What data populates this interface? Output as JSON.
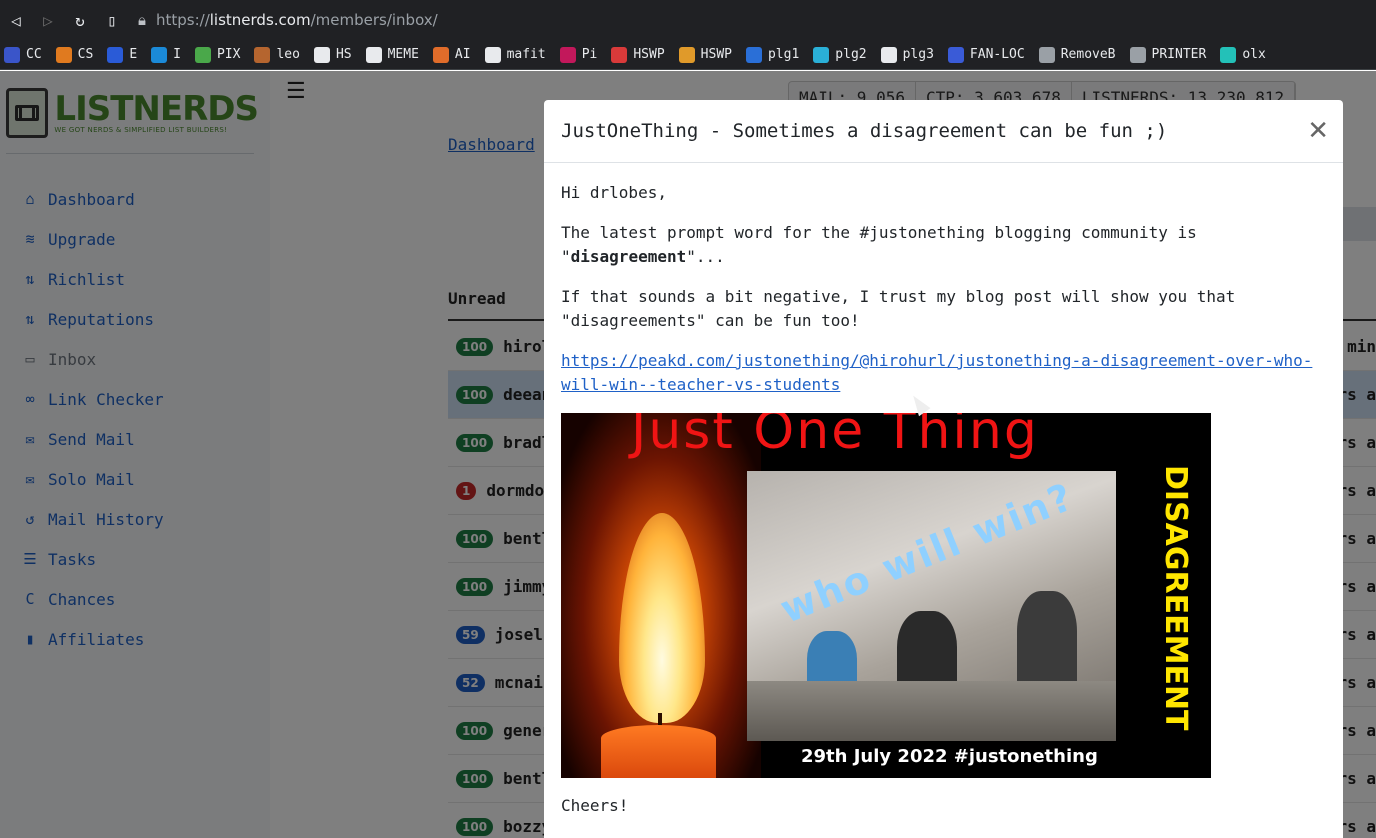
{
  "browser": {
    "url_scheme": "https://",
    "url_host": "listnerds.com",
    "url_path": "/members/inbox/",
    "bookmarks": [
      {
        "label": "CC",
        "color": "#3a55c9"
      },
      {
        "label": "CS",
        "color": "#e07a1f"
      },
      {
        "label": "E",
        "color": "#2a5bd7"
      },
      {
        "label": "I",
        "color": "#1b8ad8"
      },
      {
        "label": "PIX",
        "color": "#4aa84a"
      },
      {
        "label": "leo",
        "color": "#b5652f"
      },
      {
        "label": "HS",
        "color": "#e8eaed"
      },
      {
        "label": "MEME",
        "color": "#e8eaed"
      },
      {
        "label": "AI",
        "color": "#e06c2a"
      },
      {
        "label": "mafit",
        "color": "#e8eaed"
      },
      {
        "label": "Pi",
        "color": "#c2185b"
      },
      {
        "label": "HSWP",
        "color": "#d93a3a"
      },
      {
        "label": "HSWP",
        "color": "#e09a2a"
      },
      {
        "label": "plg1",
        "color": "#2a6fd7"
      },
      {
        "label": "plg2",
        "color": "#2ab0d7"
      },
      {
        "label": "plg3",
        "color": "#e8eaed"
      },
      {
        "label": "FAN-LOC",
        "color": "#3a5bd7"
      },
      {
        "label": "RemoveB",
        "color": "#9aa0a6"
      },
      {
        "label": "PRINTER",
        "color": "#9aa0a6"
      },
      {
        "label": "olx",
        "color": "#23c1b8"
      }
    ]
  },
  "logo": {
    "name": "LISTNERDS",
    "tagline": "WE GOT NERDS & SIMPLIFIED LIST BUILDERS!"
  },
  "sidebar": {
    "items": [
      {
        "label": "Dashboard",
        "icon": "home-icon",
        "glyph": "⌂"
      },
      {
        "label": "Upgrade",
        "icon": "layers-icon",
        "glyph": "≋"
      },
      {
        "label": "Richlist",
        "icon": "sort-icon",
        "glyph": "⇅"
      },
      {
        "label": "Reputations",
        "icon": "sort-icon",
        "glyph": "⇅"
      },
      {
        "label": "Inbox",
        "icon": "inbox-icon",
        "glyph": "▭"
      },
      {
        "label": "Link Checker",
        "icon": "link-icon",
        "glyph": "∞"
      },
      {
        "label": "Send Mail",
        "icon": "envelope-icon",
        "glyph": "✉"
      },
      {
        "label": "Solo Mail",
        "icon": "envelope-open-icon",
        "glyph": "✉"
      },
      {
        "label": "Mail History",
        "icon": "history-icon",
        "glyph": "↺"
      },
      {
        "label": "Tasks",
        "icon": "tasks-icon",
        "glyph": "☰"
      },
      {
        "label": "Chances",
        "icon": "chances-icon",
        "glyph": "C"
      },
      {
        "label": "Affiliates",
        "icon": "signal-icon",
        "glyph": "▮"
      }
    ]
  },
  "stats": {
    "mail": "MAIL: 9,056",
    "ctp": "CTP: 3,603,678",
    "listnerds": "LISTNERDS: 13,230,812"
  },
  "breadcrumb": "Dashboard",
  "table": {
    "header": "Unread",
    "rows": [
      {
        "badge": "100",
        "color": "green",
        "name": "hirol",
        "right": "min"
      },
      {
        "badge": "100",
        "color": "green",
        "name": "deean",
        "right": "rs a"
      },
      {
        "badge": "100",
        "color": "green",
        "name": "bradl",
        "right": "rs a"
      },
      {
        "badge": "1",
        "color": "red",
        "name": "dormdo",
        "right": "rs a"
      },
      {
        "badge": "100",
        "color": "green",
        "name": "bentl",
        "right": "rs a"
      },
      {
        "badge": "100",
        "color": "green",
        "name": "jimmy",
        "right": "rs a"
      },
      {
        "badge": "59",
        "color": "blue",
        "name": "josel",
        "right": "rs a"
      },
      {
        "badge": "52",
        "color": "blue",
        "name": "mcnai",
        "right": "rs a"
      },
      {
        "badge": "100",
        "color": "green",
        "name": "gener",
        "right": "rs a"
      },
      {
        "badge": "100",
        "color": "green",
        "name": "bentl",
        "right": "rs a"
      },
      {
        "badge": "100",
        "color": "green",
        "name": "bozzy",
        "right": "rs a"
      }
    ]
  },
  "modal": {
    "title": "JustOneThing - Sometimes a disagreement can be fun ;)",
    "greeting": "Hi drlobes,",
    "para1_before": "The latest prompt word for the #justonething blogging community is \"",
    "para1_bold": "disagreement",
    "para1_after": "\"...",
    "para2": "If that sounds a bit negative, I trust my blog post will show you that \"disagreements\" can be fun too!",
    "link": "https://peakd.com/justonething/@hirohurl/justonething-a-disagreement-over-who-will-win--teacher-vs-students",
    "image": {
      "title": "Just One Thing",
      "overlay_text": "who will win?",
      "vertical_text": "DISAGREEMENT",
      "caption": "29th July 2022  #justonething"
    },
    "signoff": "Cheers!"
  }
}
